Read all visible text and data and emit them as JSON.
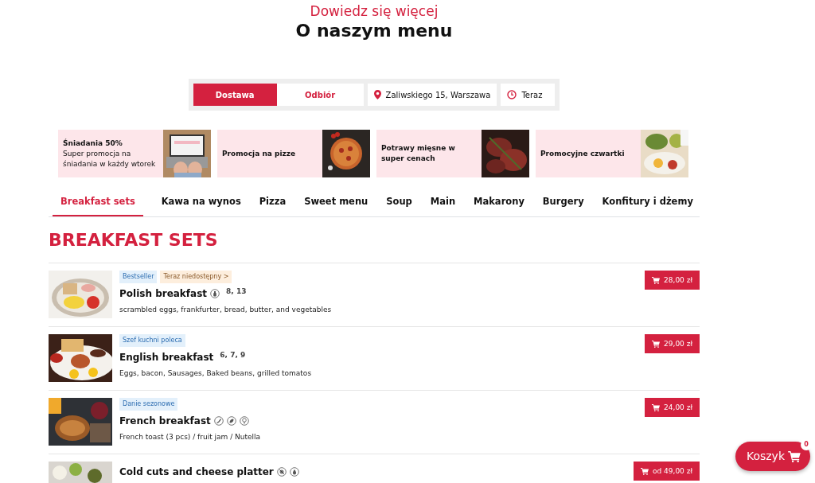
{
  "header": {
    "subtitle": "Dowiedz się więcej",
    "title": "O naszym menu"
  },
  "order_bar": {
    "modes": [
      {
        "label": "Dostawa",
        "selected": true
      },
      {
        "label": "Odbiór",
        "selected": false
      }
    ],
    "address": "Zaliwskiego 15, Warszawa",
    "time": "Teraz"
  },
  "promos": [
    {
      "title": "Śniadania 50%",
      "text": "Super promocja na śniadania w każdy wtorek"
    },
    {
      "title": "Promocja na pizze"
    },
    {
      "title": "Potrawy mięsne w super cenach"
    },
    {
      "title": "Promocyjne czwartki"
    }
  ],
  "categories": [
    {
      "label": "Breakfast sets",
      "selected": true
    },
    {
      "label": "Kawa na wynos",
      "selected": false
    },
    {
      "label": "Pizza",
      "selected": false
    },
    {
      "label": "Sweet menu",
      "selected": false
    },
    {
      "label": "Soup",
      "selected": false
    },
    {
      "label": "Main",
      "selected": false
    },
    {
      "label": "Makarony",
      "selected": false
    },
    {
      "label": "Burgery",
      "selected": false
    },
    {
      "label": "Konfitury i dżemy",
      "selected": false
    }
  ],
  "section_title": "BREAKFAST SETS",
  "dishes": [
    {
      "tags": [
        {
          "label": "Bestseller",
          "kind": "info"
        },
        {
          "label": "Teraz niedostępny >",
          "kind": "warning"
        }
      ],
      "name": "Polish breakfast",
      "icons": [
        {
          "kind": "bottle"
        }
      ],
      "allergens": "8, 13",
      "description": "scrambled eggs, frankfurter, bread, butter, and vegetables",
      "price": "28,00 zł"
    },
    {
      "tags": [
        {
          "label": "Szef kuchni poleca",
          "kind": "info"
        }
      ],
      "name": "English breakfast",
      "allergens": "6, 7, 9",
      "description": "Eggs, bacon, Sausages, Baked beans, grilled tomatos",
      "price": "29,00 zł"
    },
    {
      "tags": [
        {
          "label": "Danie sezonowe",
          "kind": "info"
        }
      ],
      "name": "French breakfast",
      "icons": [
        {
          "kind": "chili"
        },
        {
          "kind": "leaf"
        },
        {
          "kind": "broccoli"
        }
      ],
      "description": "French toast (3 pcs) / fruit jam / Nutella",
      "price": "24,00 zł"
    },
    {
      "name": "Cold cuts and cheese platter",
      "icons": [
        {
          "kind": "crossed"
        },
        {
          "kind": "drop"
        }
      ],
      "price": "od 49,00 zł"
    }
  ],
  "cart": {
    "label": "Koszyk",
    "count": "0"
  }
}
